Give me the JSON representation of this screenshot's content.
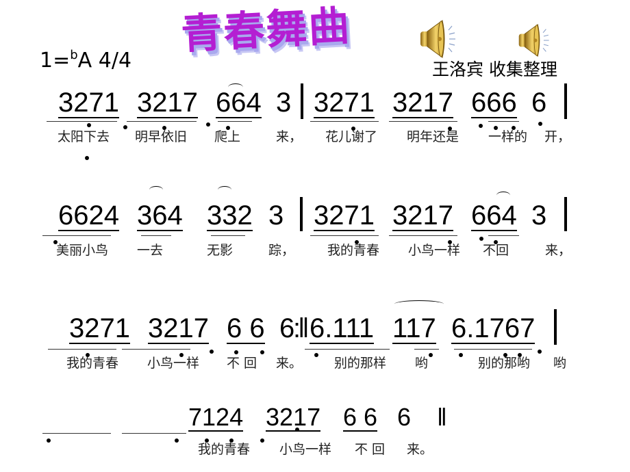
{
  "header": {
    "title_chars": [
      "青",
      "春",
      "舞",
      "曲"
    ],
    "key_prefix": "1=",
    "key_flat": "b",
    "key_note": "A",
    "time_signature": "4/4",
    "author": "王洛宾 收集整理",
    "speaker_icons": [
      "speaker-icon",
      "speaker-icon"
    ],
    "speaker_color": "#d8a930"
  },
  "rows": [
    {
      "notes": [
        "3271",
        "3217",
        "664",
        "3",
        "3271",
        "3217",
        "666",
        "6"
      ],
      "lyrics": [
        "太阳下去",
        "明早依旧",
        "爬上",
        "来，",
        "花儿谢了",
        "明年还是",
        "一样的",
        "开，"
      ]
    },
    {
      "notes": [
        "6624",
        "364",
        "332",
        "3",
        "3271",
        "3217",
        "664",
        "3"
      ],
      "lyrics": [
        "美丽小鸟",
        "一去",
        "无影",
        "踪，",
        "我的青春",
        "小鸟一样",
        "不回",
        "来，"
      ]
    },
    {
      "notes": [
        "3271",
        "3217",
        "6 6",
        "6",
        "6.111",
        "117",
        "6.1767"
      ],
      "repeat_sign": ":‖",
      "lyrics": [
        "我的青春",
        "小鸟一样",
        "不 回",
        "来。",
        "别的那样",
        "哟",
        "别的那哟",
        "哟"
      ]
    },
    {
      "notes": [
        "7124",
        "3217",
        "6 6",
        "6"
      ],
      "end_sign": "‖",
      "lyrics": [
        "我的青春",
        "小鸟一样",
        "不 回",
        "来。"
      ]
    }
  ]
}
